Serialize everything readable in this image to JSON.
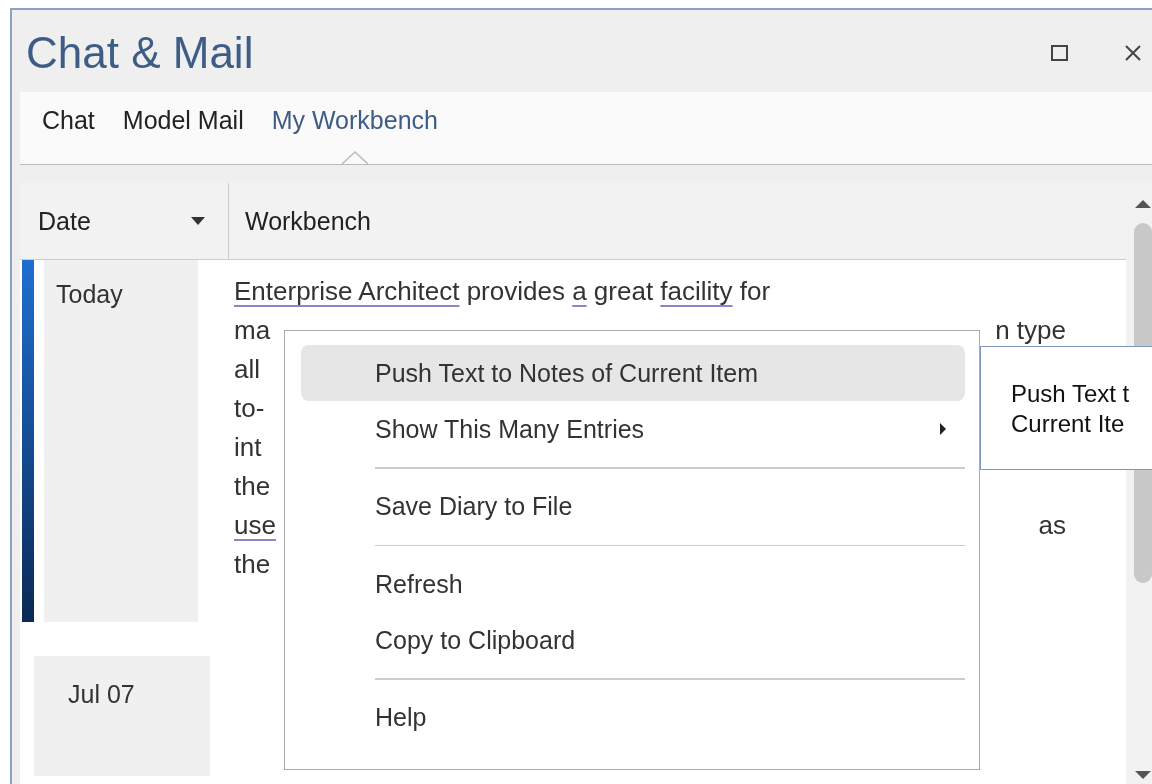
{
  "window": {
    "title": "Chat & Mail"
  },
  "tabs": [
    {
      "label": "Chat",
      "selected": false
    },
    {
      "label": "Model Mail",
      "selected": false
    },
    {
      "label": "My Workbench",
      "selected": true
    }
  ],
  "table": {
    "columns": [
      "Date",
      "Workbench"
    ],
    "rows": [
      {
        "date": "Today",
        "selected": true,
        "lines": [
          {
            "left": [
              {
                "text": "Enterprise Architect",
                "underlined": true
              },
              {
                "text": " provides ",
                "underlined": false
              },
              {
                "text": "a",
                "underlined": true
              },
              {
                "text": " great ",
                "underlined": false
              },
              {
                "text": "facility",
                "underlined": true
              },
              {
                "text": " for",
                "underlined": false
              }
            ]
          },
          {
            "left": [
              {
                "text": "ma",
                "underlined": false
              }
            ],
            "right": "n type"
          },
          {
            "left": [
              {
                "text": "all",
                "underlined": false
              }
            ]
          },
          {
            "left": [
              {
                "text": "to-",
                "underlined": false
              }
            ]
          },
          {
            "left": [
              {
                "text": "int",
                "underlined": false
              }
            ]
          },
          {
            "left": [
              {
                "text": "the",
                "underlined": false
              }
            ]
          },
          {
            "left": [
              {
                "text": "use",
                "underlined": true
              }
            ],
            "right": "as"
          },
          {
            "left": [
              {
                "text": "the",
                "underlined": false
              }
            ]
          }
        ]
      },
      {
        "date": "Jul 07",
        "selected": false,
        "lines": []
      }
    ]
  },
  "context_menu": {
    "groups": [
      [
        {
          "label": "Push Text to Notes of Current Item",
          "selected": true,
          "submenu": false
        },
        {
          "label": "Show This Many Entries",
          "selected": false,
          "submenu": true
        }
      ],
      [
        {
          "label": "Save Diary to File",
          "selected": false,
          "submenu": false
        }
      ],
      [
        {
          "label": "Refresh",
          "selected": false,
          "submenu": false
        },
        {
          "label": "Copy to Clipboard",
          "selected": false,
          "submenu": false
        }
      ],
      [
        {
          "label": "Help",
          "selected": false,
          "submenu": false
        }
      ]
    ]
  },
  "tooltip": {
    "lines": [
      "Push Text t",
      "Current Ite"
    ]
  }
}
